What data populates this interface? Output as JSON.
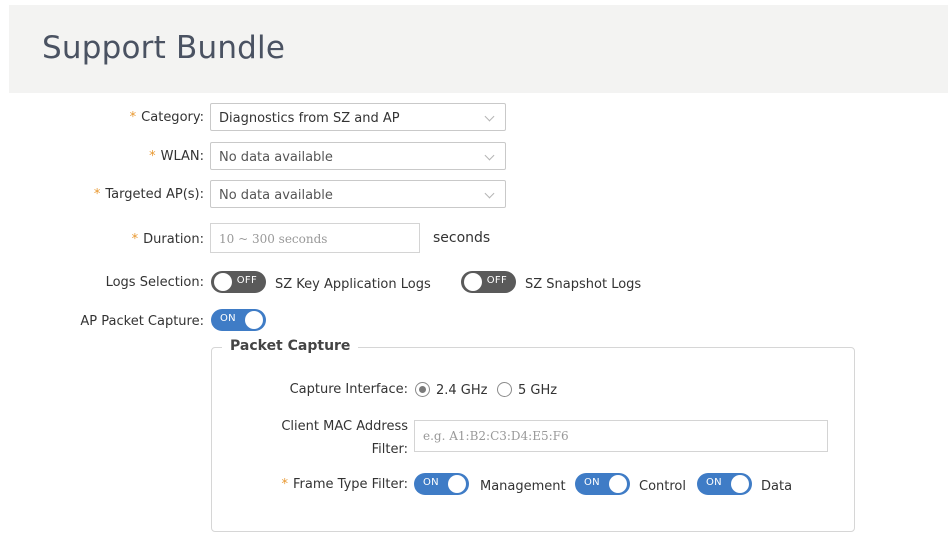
{
  "header": {
    "title": "Support Bundle"
  },
  "form": {
    "category": {
      "label": "Category:",
      "value": "Diagnostics from SZ and AP"
    },
    "wlan": {
      "label": "WLAN:",
      "value": "No data available"
    },
    "targeted_aps": {
      "label": "Targeted AP(s):",
      "value": "No data available"
    },
    "duration": {
      "label": "Duration:",
      "placeholder": "10 ~ 300 seconds",
      "unit": "seconds"
    },
    "logs_selection": {
      "label": "Logs Selection:",
      "key_app_logs": {
        "state": "OFF",
        "label": "SZ Key Application Logs"
      },
      "snapshot_logs": {
        "state": "OFF",
        "label": "SZ Snapshot Logs"
      }
    },
    "ap_packet_capture": {
      "label": "AP Packet Capture:",
      "state": "ON"
    }
  },
  "packet_capture": {
    "title": "Packet Capture",
    "capture_interface": {
      "label": "Capture Interface:",
      "options": [
        "2.4 GHz",
        "5 GHz"
      ],
      "selected": "2.4 GHz"
    },
    "client_mac": {
      "label_line1": "Client MAC Address",
      "label_line2": "Filter:",
      "placeholder": "e.g. A1:B2:C3:D4:E5:F6"
    },
    "frame_type_filter": {
      "label": "Frame Type Filter:",
      "management": {
        "state": "ON",
        "label": "Management"
      },
      "control": {
        "state": "ON",
        "label": "Control"
      },
      "data": {
        "state": "ON",
        "label": "Data"
      }
    }
  },
  "colors": {
    "required": "#e8972e",
    "toggle_on": "#3f7cc6",
    "toggle_off": "#5a5a5a"
  }
}
